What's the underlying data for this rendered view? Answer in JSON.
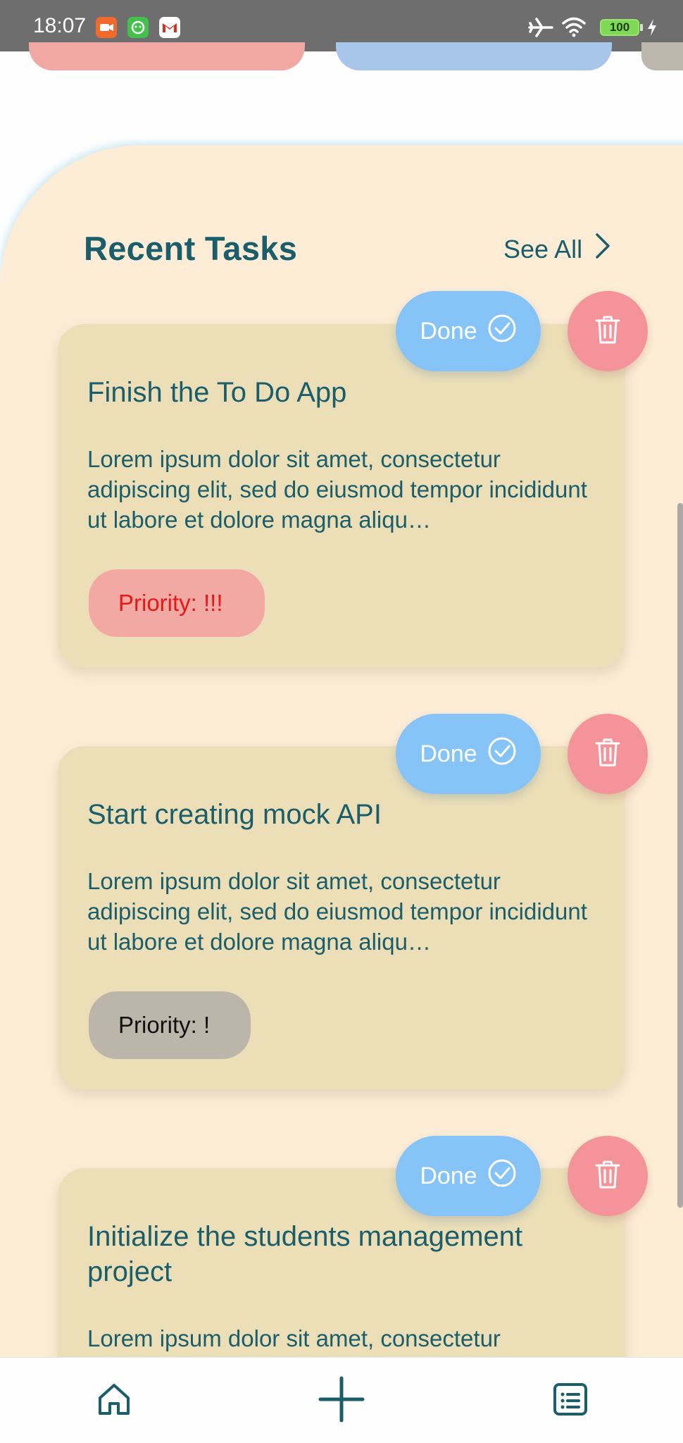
{
  "status_bar": {
    "time": "18:07",
    "battery": "100",
    "notification_icons": [
      "video-call-icon",
      "chat-app-icon",
      "gmail-icon"
    ],
    "right_icons": [
      "airplane-mode-icon",
      "wifi-icon",
      "battery-icon",
      "charging-icon"
    ]
  },
  "section": {
    "title": "Recent Tasks",
    "see_all_label": "See All"
  },
  "tasks": [
    {
      "title": "Finish the To Do App",
      "description": "Lorem ipsum dolor sit amet, consectetur adipiscing elit, sed do eiusmod tempor incididunt ut labore et dolore magna aliqu…",
      "priority": "Priority: !!!",
      "done_label": "Done"
    },
    {
      "title": "Start creating mock API",
      "description": "Lorem ipsum dolor sit amet, consectetur adipiscing elit, sed do eiusmod tempor incididunt ut labore et dolore magna aliqu…",
      "priority": "Priority: !",
      "done_label": "Done"
    },
    {
      "title": "Initialize the students management project",
      "description": "Lorem ipsum dolor sit amet, consectetur",
      "done_label": "Done"
    }
  ],
  "bottom_nav": [
    "home-icon",
    "add-icon",
    "task-list-icon"
  ],
  "colors": {
    "panel_bg": "#fdedd7",
    "card_bg": "#ecdfb8",
    "text_primary": "#1b5e6b",
    "done_button": "#86c4f7",
    "delete_button": "#f4949a",
    "priority_high_bg": "#f3a9a3",
    "priority_high_text": "#e51818",
    "priority_low_bg": "#bbb5aa"
  }
}
